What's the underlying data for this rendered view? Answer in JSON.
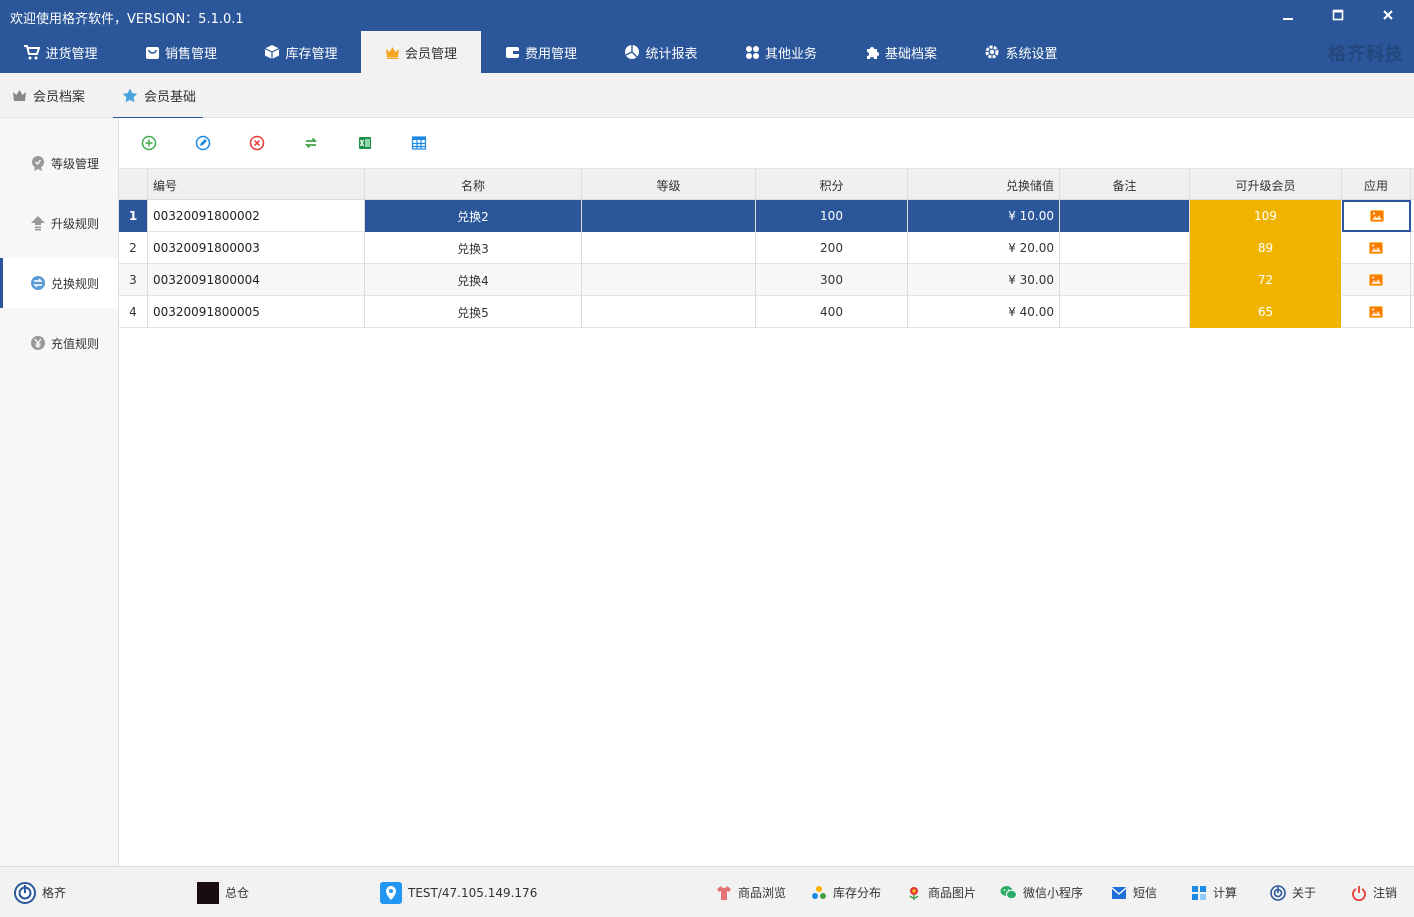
{
  "window": {
    "title": "欢迎使用格齐软件，VERSION：5.1.0.1",
    "minimize_icon": "minimize-icon",
    "maximize_icon": "maximize-icon",
    "close_icon": "close-icon"
  },
  "menu": {
    "items": [
      {
        "label": "进货管理",
        "icon": "cart-icon"
      },
      {
        "label": "销售管理",
        "icon": "bag-icon"
      },
      {
        "label": "库存管理",
        "icon": "box-icon"
      },
      {
        "label": "会员管理",
        "icon": "crown-icon",
        "active": true
      },
      {
        "label": "费用管理",
        "icon": "wallet-icon"
      },
      {
        "label": "统计报表",
        "icon": "pie-chart-icon"
      },
      {
        "label": "其他业务",
        "icon": "apps-icon"
      },
      {
        "label": "基础档案",
        "icon": "puzzle-icon"
      },
      {
        "label": "系统设置",
        "icon": "gear-icon"
      }
    ],
    "brand": "格齐科技",
    "accent": "#2b579a"
  },
  "subtabs": [
    {
      "label": "会员档案",
      "icon": "crown-outline-icon"
    },
    {
      "label": "会员基础",
      "icon": "star-icon",
      "active": true
    }
  ],
  "sidebar": {
    "items": [
      {
        "label": "等级管理",
        "icon": "medal-icon"
      },
      {
        "label": "升级规则",
        "icon": "upgrade-arrow-icon"
      },
      {
        "label": "兑换规则",
        "icon": "exchange-icon",
        "active": true
      },
      {
        "label": "充值规则",
        "icon": "yen-icon"
      }
    ]
  },
  "toolbar": {
    "tools": [
      "add-icon",
      "edit-icon",
      "delete-icon",
      "refresh-icon",
      "excel-icon",
      "grid-settings-icon"
    ]
  },
  "table": {
    "columns": [
      "编号",
      "名称",
      "等级",
      "积分",
      "兑换储值",
      "备注",
      "可升级会员",
      "应用"
    ],
    "rows": [
      {
        "no": "1",
        "code": "00320091800002",
        "name": "兑换2",
        "level": "",
        "points": "100",
        "value": "¥ 10.00",
        "note": "",
        "upgradable": "109"
      },
      {
        "no": "2",
        "code": "00320091800003",
        "name": "兑换3",
        "level": "",
        "points": "200",
        "value": "¥ 20.00",
        "note": "",
        "upgradable": "89"
      },
      {
        "no": "3",
        "code": "00320091800004",
        "name": "兑换4",
        "level": "",
        "points": "300",
        "value": "¥ 30.00",
        "note": "",
        "upgradable": "72"
      },
      {
        "no": "4",
        "code": "00320091800005",
        "name": "兑换5",
        "level": "",
        "points": "400",
        "value": "¥ 40.00",
        "note": "",
        "upgradable": "65"
      }
    ],
    "selected_row": 1,
    "upgradable_color": "#f0b400"
  },
  "status": {
    "user": "格齐",
    "warehouse": "总仓",
    "server": "TEST/47.105.149.176",
    "links": [
      {
        "label": "商品浏览",
        "icon": "shirt-icon"
      },
      {
        "label": "库存分布",
        "icon": "distribution-icon"
      },
      {
        "label": "商品图片",
        "icon": "flower-icon"
      },
      {
        "label": "微信小程序",
        "icon": "wechat-icon"
      },
      {
        "label": "短信",
        "icon": "mail-icon"
      },
      {
        "label": "计算",
        "icon": "calculator-icon"
      },
      {
        "label": "关于",
        "icon": "info-icon"
      },
      {
        "label": "注销",
        "icon": "power-icon"
      }
    ]
  }
}
